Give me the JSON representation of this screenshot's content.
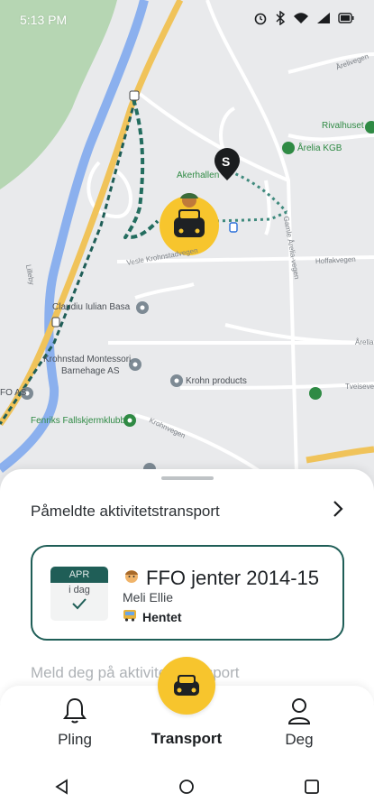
{
  "status_bar": {
    "time": "5:13 PM",
    "icons": [
      "alarm-icon",
      "bluetooth-icon",
      "wifi-icon",
      "signal-icon",
      "battery-icon"
    ]
  },
  "map": {
    "labels": {
      "akerhallen": "Akerhallen",
      "rivalhuset": "Rivalhuset",
      "arelia_kgb": "Årelia KGB",
      "claudiu": "Claudiu Iulian Basa",
      "montessori_1": "Krohnstad Montessori",
      "montessori_2": "Barnehage AS",
      "krohn": "Krohn products",
      "fallskjerm": "Fenriks Fallskjermklubb",
      "fo_as": "FO AS",
      "aslivegen": "Årelivegen",
      "gamle_arelia": "Gamle Årelia-vegen",
      "vesle_krohn": "Vesle Krohnstadvegen",
      "hoffakvegen": "Hoffakvegen",
      "areliv": "Årelia",
      "krohnvegen": "Krohnvegen",
      "tveiseveien": "Tveiseveien",
      "lilleby": "Lilleby"
    },
    "stop_marker": "S",
    "colors": {
      "route": "#236d5f",
      "road_major": "#f0c35a",
      "river": "#8bb0ee",
      "park": "#b6d6b3"
    }
  },
  "sheet": {
    "section_title": "Påmeldte aktivitetstransport",
    "card": {
      "month": "APR",
      "day_label": "i dag",
      "title": "FFO jenter 2014-15",
      "person": "Meli Ellie",
      "status": "Hentet"
    },
    "faded_text": "Meld deg på aktivitetstransport"
  },
  "bottom_nav": {
    "items": [
      {
        "label": "Pling",
        "icon": "bell-icon"
      },
      {
        "label": "Transport",
        "icon": "car-icon"
      },
      {
        "label": "Deg",
        "icon": "person-icon"
      }
    ],
    "accent": "#f7c52d"
  }
}
